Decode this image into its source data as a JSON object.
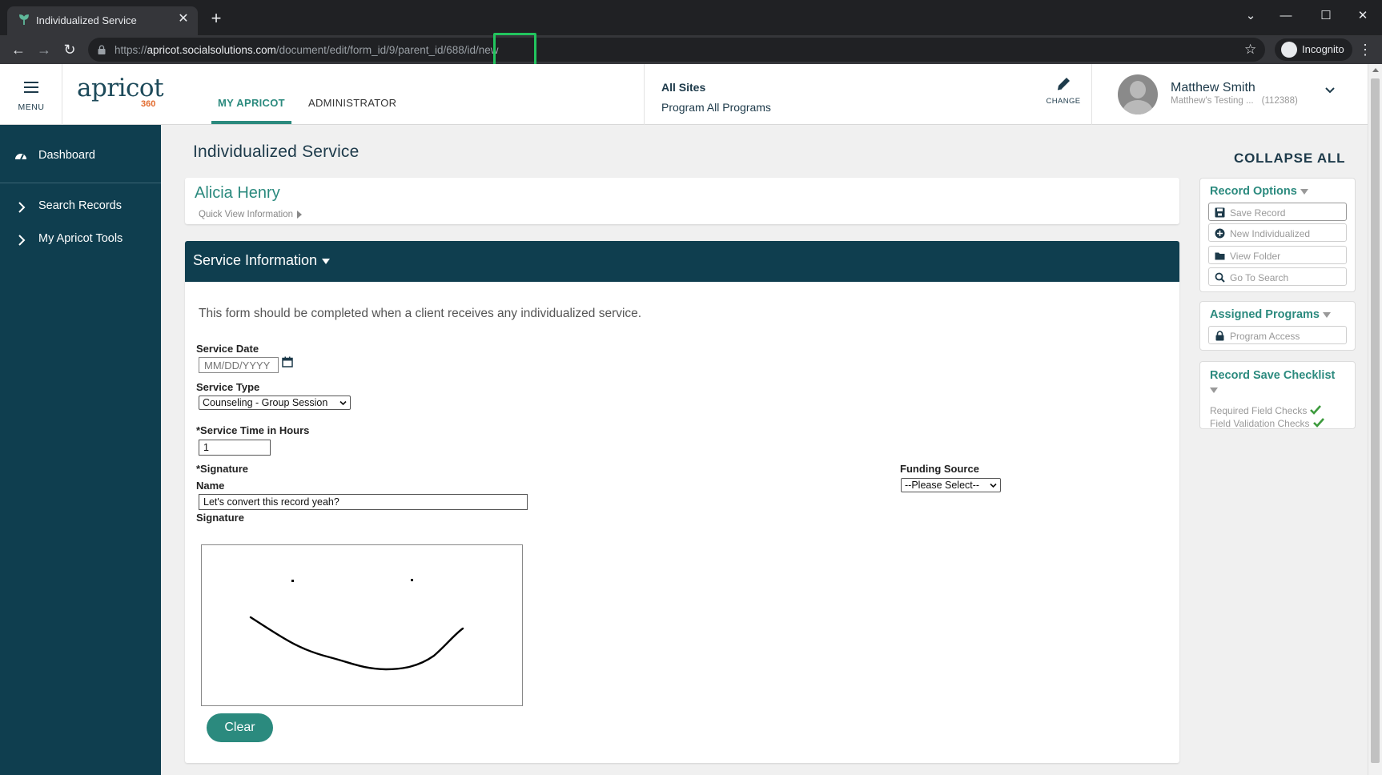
{
  "browser": {
    "tab_title": "Individualized Service",
    "url_scheme": "https://",
    "url_host": "apricot.socialsolutions.com",
    "url_path": "/document/edit/form_id/9/parent_id/688/id/new",
    "incognito_label": "Incognito"
  },
  "header": {
    "menu_label": "MENU",
    "logo_text": "apricot",
    "logo_sub": "360",
    "nav_tabs": [
      {
        "label": "MY APRICOT",
        "active": true
      },
      {
        "label": "ADMINISTRATOR",
        "active": false
      }
    ],
    "sites_title": "All Sites",
    "sites_program": "Program All Programs",
    "change_label": "CHANGE",
    "user_name": "Matthew Smith",
    "user_org": "Matthew's Testing ...",
    "user_id": "(112388)"
  },
  "sidebar": {
    "items": [
      {
        "label": "Dashboard",
        "icon": "dashboard-icon"
      },
      {
        "label": "Search Records",
        "icon": "chevron-right-icon"
      },
      {
        "label": "My Apricot Tools",
        "icon": "chevron-right-icon"
      }
    ]
  },
  "main": {
    "page_title": "Individualized Service",
    "client_name": "Alicia Henry",
    "quick_view_label": "Quick View Information",
    "section_title": "Service Information",
    "intro_text": "This form should be completed when a client receives any individualized service.",
    "fields": {
      "service_date_label": "Service Date",
      "service_date_placeholder": "MM/DD/YYYY",
      "service_type_label": "Service Type",
      "service_type_value": "Counseling - Group Session",
      "service_time_label": "*Service Time in Hours",
      "service_time_value": "1",
      "signature_section_label": "*Signature",
      "name_label": "Name",
      "name_value": "Let's convert this record yeah?",
      "signature_label": "Signature",
      "funding_source_label": "Funding Source",
      "funding_source_value": "--Please Select--"
    },
    "clear_label": "Clear"
  },
  "right": {
    "collapse_all_label": "COLLAPSE ALL",
    "record_options": {
      "title": "Record Options",
      "buttons": [
        {
          "label": "Save Record",
          "icon": "save-icon"
        },
        {
          "label": "New Individualized",
          "icon": "plus-circle-icon"
        },
        {
          "label": "View Folder",
          "icon": "folder-icon"
        },
        {
          "label": "Go To Search",
          "icon": "search-icon"
        }
      ]
    },
    "assigned_programs": {
      "title": "Assigned Programs",
      "buttons": [
        {
          "label": "Program Access",
          "icon": "lock-icon"
        }
      ]
    },
    "checklist": {
      "title": "Record Save Checklist",
      "items": [
        {
          "label": "Required Field Checks",
          "status": "passed"
        },
        {
          "label": "Field Validation Checks",
          "status": "passed"
        }
      ]
    }
  },
  "colors": {
    "brand_dark": "#0f3e4f",
    "brand_teal": "#2b8a7e",
    "highlight": "#22c55e"
  }
}
